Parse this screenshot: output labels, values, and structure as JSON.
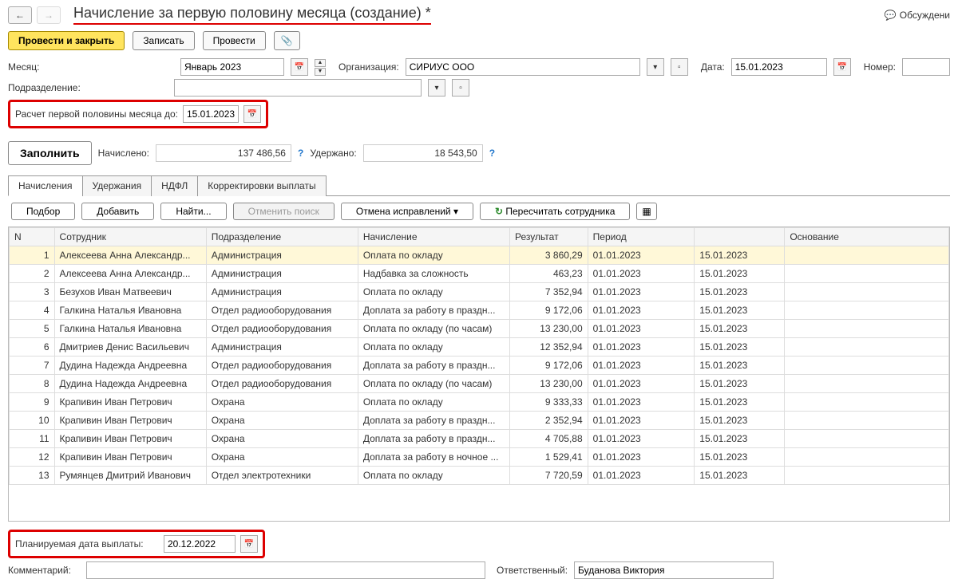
{
  "title": "Начисление за первую половину месяца (создание) *",
  "discuss_label": "Обсуждени",
  "buttons": {
    "post_close": "Провести и закрыть",
    "save": "Записать",
    "post": "Провести"
  },
  "labels": {
    "month": "Месяц:",
    "org": "Организация:",
    "date": "Дата:",
    "number": "Номер:",
    "division": "Подразделение:",
    "calc_until": "Расчет первой половины месяца до:",
    "accrued": "Начислено:",
    "withheld": "Удержано:",
    "fill": "Заполнить",
    "planned_date": "Планируемая дата выплаты:",
    "comment": "Комментарий:",
    "responsible": "Ответственный:"
  },
  "fields": {
    "month": "Январь 2023",
    "org": "СИРИУС ООО",
    "date": "15.01.2023",
    "number": "",
    "division": "",
    "calc_until": "15.01.2023",
    "accrued": "137 486,56",
    "withheld": "18 543,50",
    "planned_date": "20.12.2022",
    "comment": "",
    "responsible": "Буданова Виктория"
  },
  "tabs": [
    "Начисления",
    "Удержания",
    "НДФЛ",
    "Корректировки выплаты"
  ],
  "tab_toolbar": {
    "select": "Подбор",
    "add": "Добавить",
    "find": "Найти...",
    "cancel_search": "Отменить поиск",
    "cancel_fix": "Отмена исправлений",
    "recalc": "Пересчитать сотрудника"
  },
  "cols": {
    "n": "N",
    "employee": "Сотрудник",
    "division": "Подразделение",
    "accrual": "Начисление",
    "result": "Результат",
    "period": "Период",
    "period_end": "",
    "basis": "Основание"
  },
  "rows": [
    {
      "n": "1",
      "emp": "Алексеева Анна Александр...",
      "div": "Администрация",
      "acc": "Оплата по окладу",
      "res": "3 860,29",
      "p1": "01.01.2023",
      "p2": "15.01.2023",
      "sel": true
    },
    {
      "n": "2",
      "emp": "Алексеева Анна Александр...",
      "div": "Администрация",
      "acc": "Надбавка за сложность",
      "res": "463,23",
      "p1": "01.01.2023",
      "p2": "15.01.2023"
    },
    {
      "n": "3",
      "emp": "Безухов Иван Матвеевич",
      "div": "Администрация",
      "acc": "Оплата по окладу",
      "res": "7 352,94",
      "p1": "01.01.2023",
      "p2": "15.01.2023"
    },
    {
      "n": "4",
      "emp": "Галкина Наталья Ивановна",
      "div": "Отдел радиооборудования",
      "acc": "Доплата за работу в праздн...",
      "res": "9 172,06",
      "p1": "01.01.2023",
      "p2": "15.01.2023"
    },
    {
      "n": "5",
      "emp": "Галкина Наталья Ивановна",
      "div": "Отдел радиооборудования",
      "acc": "Оплата по окладу (по часам)",
      "res": "13 230,00",
      "p1": "01.01.2023",
      "p2": "15.01.2023"
    },
    {
      "n": "6",
      "emp": "Дмитриев Денис Васильевич",
      "div": "Администрация",
      "acc": "Оплата по окладу",
      "res": "12 352,94",
      "p1": "01.01.2023",
      "p2": "15.01.2023"
    },
    {
      "n": "7",
      "emp": "Дудина Надежда Андреевна",
      "div": "Отдел радиооборудования",
      "acc": "Доплата за работу в праздн...",
      "res": "9 172,06",
      "p1": "01.01.2023",
      "p2": "15.01.2023"
    },
    {
      "n": "8",
      "emp": "Дудина Надежда Андреевна",
      "div": "Отдел радиооборудования",
      "acc": "Оплата по окладу (по часам)",
      "res": "13 230,00",
      "p1": "01.01.2023",
      "p2": "15.01.2023"
    },
    {
      "n": "9",
      "emp": "Крапивин Иван Петрович",
      "div": "Охрана",
      "acc": "Оплата по окладу",
      "res": "9 333,33",
      "p1": "01.01.2023",
      "p2": "15.01.2023"
    },
    {
      "n": "10",
      "emp": "Крапивин Иван Петрович",
      "div": "Охрана",
      "acc": "Доплата за работу в праздн...",
      "res": "2 352,94",
      "p1": "01.01.2023",
      "p2": "15.01.2023"
    },
    {
      "n": "11",
      "emp": "Крапивин Иван Петрович",
      "div": "Охрана",
      "acc": "Доплата за работу в праздн...",
      "res": "4 705,88",
      "p1": "01.01.2023",
      "p2": "15.01.2023"
    },
    {
      "n": "12",
      "emp": "Крапивин Иван Петрович",
      "div": "Охрана",
      "acc": "Доплата за работу в ночное ...",
      "res": "1 529,41",
      "p1": "01.01.2023",
      "p2": "15.01.2023"
    },
    {
      "n": "13",
      "emp": "Румянцев Дмитрий Иванович",
      "div": "Отдел электротехники",
      "acc": "Оплата по окладу",
      "res": "7 720,59",
      "p1": "01.01.2023",
      "p2": "15.01.2023"
    }
  ]
}
